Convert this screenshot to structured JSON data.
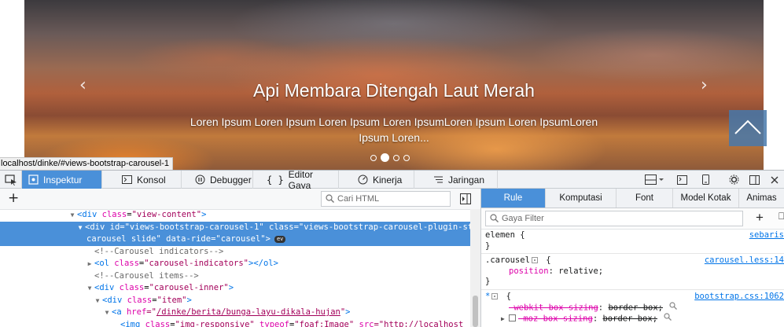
{
  "carousel": {
    "title": "Api Membara Ditengah Laut Merah",
    "text": "Loren Ipsum Loren Ipsum Loren Ipsum Loren IpsumLoren Ipsum Loren IpsumLoren Ipsum Loren...",
    "prev_icon": "‹",
    "next_icon": "›",
    "indicators": [
      false,
      true,
      false,
      false
    ]
  },
  "url_tooltip": "localhost/dinke/#views-bootstrap-carousel-1",
  "devtools": {
    "tabs": {
      "inspector": "Inspektur",
      "console": "Konsol",
      "debugger": "Debugger",
      "style_editor": "Editor Gaya",
      "performance": "Kinerja",
      "network": "Jaringan"
    },
    "markup": {
      "search_placeholder": "Cari HTML",
      "lines": {
        "l1": {
          "tag_open": "<div",
          "attr": "class",
          "val": "\"view-content\"",
          "tag_close": ">"
        },
        "l2a": {
          "tag_open": "<div",
          "attr1": "id",
          "val1": "\"views-bootstrap-carousel-1\"",
          "attr2": "class",
          "val2": "\"views-bootstrap-carousel-plugin-style"
        },
        "l2b": {
          "val": "carousel slide\"",
          "attr": "data-ride",
          "val2": "\"carousel\"",
          "tag_close": ">",
          "badge": "ev"
        },
        "l3": "<!--Carousel indicators-->",
        "l4": {
          "tag_open": "<ol",
          "attr": "class",
          "val": "\"carousel-indicators\"",
          "tag_close": "></ol>"
        },
        "l5": "<!--Carousel items-->",
        "l6": {
          "tag_open": "<div",
          "attr": "class",
          "val": "\"carousel-inner\"",
          "tag_close": ">"
        },
        "l7": {
          "tag_open": "<div",
          "attr": "class",
          "val": "\"item\"",
          "tag_close": ">"
        },
        "l8": {
          "tag_open": "<a",
          "attr": "href",
          "q1": "=\"",
          "link": "/dinke/berita/bunga-layu-dikala-hujan",
          "q2": "\"",
          "tag_close": ">"
        },
        "l9": {
          "tag_open": "<img",
          "attr1": "class",
          "val1": "\"img-responsive\"",
          "attr2": "typeof",
          "val2": "\"foaf:Image\"",
          "attr3": "src",
          "q1": "=\"",
          "link": "http://localhost"
        }
      }
    },
    "sidebar": {
      "tabs": [
        "Rule",
        "Komputasi",
        "Font",
        "Model Kotak",
        "Animas"
      ],
      "filter_placeholder": "Gaya Filter",
      "rules": {
        "r1": {
          "selector": "elemen {",
          "source": "sebaris",
          "close": "}"
        },
        "r2": {
          "selector": ".carousel",
          "open": "{",
          "source": "carousel.less:14",
          "prop": "position",
          "value": "relative;",
          "close": "}"
        },
        "r3": {
          "selector": "*",
          "open": "{",
          "source": "bootstrap.css:1062",
          "prop1": "-webkit-box-sizing",
          "val1": "border-box;",
          "prop2": "-moz-box-sizing",
          "val2": "border-box;"
        }
      }
    }
  },
  "colors": {
    "accent": "#4a90d9",
    "tag": "#0074e8",
    "attribute": "#dd00a9",
    "value": "#a3005a"
  }
}
